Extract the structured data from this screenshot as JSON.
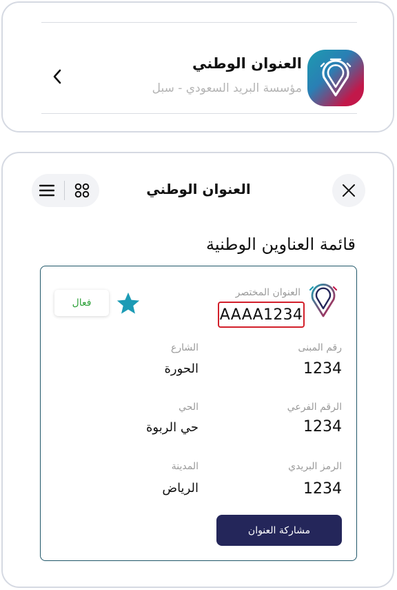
{
  "app_header": {
    "title": "العنوان الوطني",
    "subtitle": "مؤسسة البريد السعودي - سبل",
    "icon": "national-address-pin-icon",
    "back_icon": "chevron-left-icon"
  },
  "nav": {
    "title": "العنوان الوطني",
    "close_icon": "close-icon",
    "grid_icon": "grid-dots-icon",
    "menu_icon": "hamburger-menu-icon"
  },
  "page": {
    "heading": "قائمة العناوين الوطنية"
  },
  "card": {
    "short_label": "العنوان المختصر",
    "short_code": "AAAA1234",
    "status": "فعال",
    "favorite_icon": "star-icon",
    "fields": {
      "building_label": "رقم المبنى",
      "building_value": "1234",
      "street_label": "الشارع",
      "street_value": "الحورة",
      "secondary_label": "الرقم الفرعي",
      "secondary_value": "1234",
      "district_label": "الحي",
      "district_value": "حي الربوة",
      "postal_label": "الرمز البريدي",
      "postal_value": "1234",
      "city_label": "المدينة",
      "city_value": "الرياض"
    },
    "share_label": "مشاركة العنوان"
  },
  "colors": {
    "accent_teal": "#1d9bb0",
    "accent_red": "#c2184a",
    "button_navy": "#24265a",
    "status_green": "#2ea13a",
    "highlight_red": "#d21f2a"
  }
}
